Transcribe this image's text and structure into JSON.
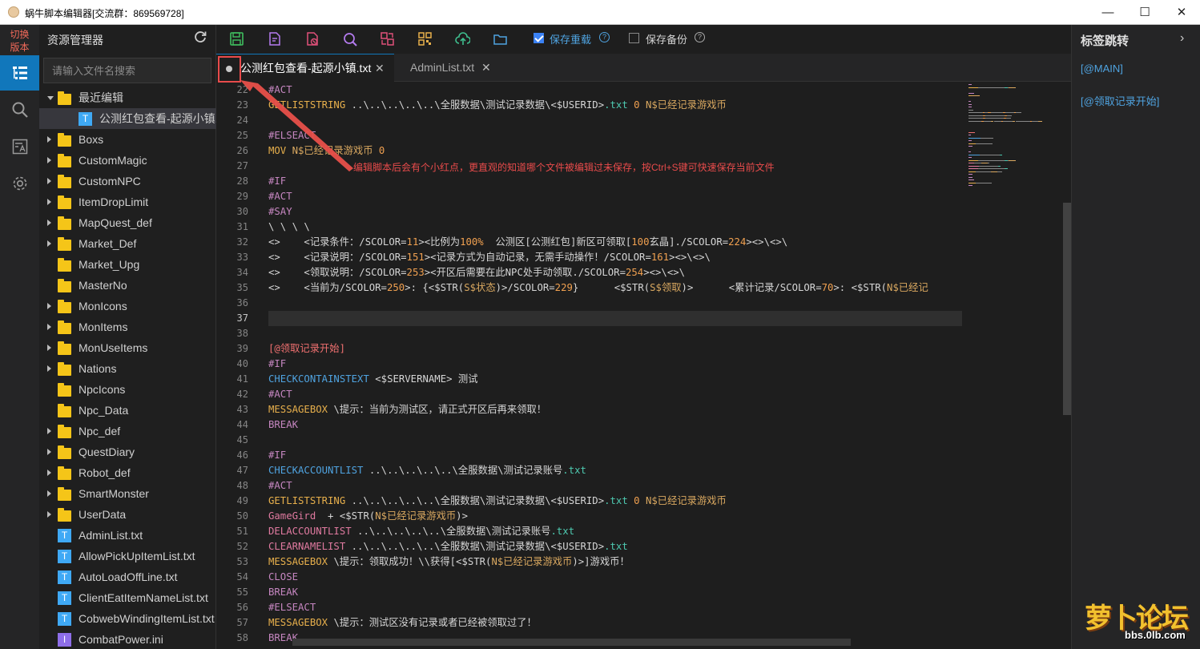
{
  "window": {
    "title": "蜗牛脚本编辑器[交流群：869569728]",
    "minimize_glyph": "—",
    "maximize_glyph": "☐",
    "close_glyph": "✕"
  },
  "activity_bar": {
    "switch_label_1": "切换",
    "switch_label_2": "版本",
    "items": [
      {
        "icon": "explorer-icon",
        "active": true
      },
      {
        "icon": "search-icon",
        "active": false
      },
      {
        "icon": "font-icon",
        "active": false
      },
      {
        "icon": "gear-icon",
        "active": false
      }
    ]
  },
  "explorer": {
    "title": "资源管理器",
    "refresh_icon": "refresh-icon",
    "search_placeholder": "请输入文件名搜索",
    "tree": [
      {
        "label": "最近编辑",
        "kind": "folder",
        "depth": 0,
        "expanded": true,
        "twisty": true
      },
      {
        "label": "公测红包查看-起源小镇.txt",
        "kind": "file",
        "depth": 1,
        "selected": true,
        "twisty": false
      },
      {
        "label": "Boxs",
        "kind": "folder",
        "depth": 0,
        "twisty": true
      },
      {
        "label": "CustomMagic",
        "kind": "folder",
        "depth": 0,
        "twisty": true
      },
      {
        "label": "CustomNPC",
        "kind": "folder",
        "depth": 0,
        "twisty": true
      },
      {
        "label": "ItemDropLimit",
        "kind": "folder",
        "depth": 0,
        "twisty": true
      },
      {
        "label": "MapQuest_def",
        "kind": "folder",
        "depth": 0,
        "twisty": true
      },
      {
        "label": "Market_Def",
        "kind": "folder",
        "depth": 0,
        "twisty": true
      },
      {
        "label": "Market_Upg",
        "kind": "folder",
        "depth": 0,
        "twisty": false
      },
      {
        "label": "MasterNo",
        "kind": "folder",
        "depth": 0,
        "twisty": false
      },
      {
        "label": "MonIcons",
        "kind": "folder",
        "depth": 0,
        "twisty": true
      },
      {
        "label": "MonItems",
        "kind": "folder",
        "depth": 0,
        "twisty": true
      },
      {
        "label": "MonUseItems",
        "kind": "folder",
        "depth": 0,
        "twisty": true
      },
      {
        "label": "Nations",
        "kind": "folder",
        "depth": 0,
        "twisty": true
      },
      {
        "label": "NpcIcons",
        "kind": "folder",
        "depth": 0,
        "twisty": false
      },
      {
        "label": "Npc_Data",
        "kind": "folder",
        "depth": 0,
        "twisty": false
      },
      {
        "label": "Npc_def",
        "kind": "folder",
        "depth": 0,
        "twisty": true
      },
      {
        "label": "QuestDiary",
        "kind": "folder",
        "depth": 0,
        "twisty": true
      },
      {
        "label": "Robot_def",
        "kind": "folder",
        "depth": 0,
        "twisty": true
      },
      {
        "label": "SmartMonster",
        "kind": "folder",
        "depth": 0,
        "twisty": true
      },
      {
        "label": "UserData",
        "kind": "folder",
        "depth": 0,
        "twisty": true
      },
      {
        "label": "AdminList.txt",
        "kind": "file",
        "depth": 0,
        "twisty": false
      },
      {
        "label": "AllowPickUpItemList.txt",
        "kind": "file",
        "depth": 0,
        "twisty": false
      },
      {
        "label": "AutoLoadOffLine.txt",
        "kind": "file",
        "depth": 0,
        "twisty": false
      },
      {
        "label": "ClientEatItemNameList.txt",
        "kind": "file",
        "depth": 0,
        "twisty": false
      },
      {
        "label": "CobwebWindingItemList.txt",
        "kind": "file",
        "depth": 0,
        "twisty": false
      },
      {
        "label": "CombatPower.ini",
        "kind": "ini",
        "depth": 0,
        "twisty": false
      }
    ]
  },
  "toolbar": {
    "buttons": [
      {
        "icon": "save-icon",
        "color": "#3fbf5f"
      },
      {
        "icon": "edit-doc-icon",
        "color": "#b57cf0"
      },
      {
        "icon": "delete-doc-icon",
        "color": "#e0507a"
      },
      {
        "icon": "find-icon",
        "color": "#b57cf0"
      },
      {
        "icon": "replace-icon",
        "color": "#e0507a"
      },
      {
        "icon": "qrcode-icon",
        "color": "#e8b04c"
      },
      {
        "icon": "upload-cloud-icon",
        "color": "#3fbf8f"
      },
      {
        "icon": "open-folder-icon",
        "color": "#4fa3e0"
      }
    ],
    "save_reload": {
      "label": "保存重载",
      "checked": true,
      "help": "?"
    },
    "save_backup": {
      "label": "保存备份",
      "checked": false,
      "help": "?"
    }
  },
  "tabs": [
    {
      "label": "公测红包查看-起源小镇.txt",
      "active": true,
      "dirty": true,
      "close": "✕"
    },
    {
      "label": "AdminList.txt",
      "active": false,
      "dirty": false,
      "close": "✕"
    }
  ],
  "editor": {
    "current_line": 37,
    "annotation": "编辑脚本后会有个小红点，更直观的知道哪个文件被编辑过未保存，按Ctrl+S键可快速保存当前文件",
    "lines": [
      {
        "n": 22,
        "seg": [
          [
            "#ACT",
            "k-sec"
          ]
        ]
      },
      {
        "n": 23,
        "seg": [
          [
            "GETLISTSTRING",
            "k-cmd"
          ],
          [
            " ..\\..\\..\\..\\..\\全服数据\\测试记录数据\\<$USERID>",
            "k-str"
          ],
          [
            ".txt",
            "k-ext"
          ],
          [
            " ",
            "k-str"
          ],
          [
            "0",
            "k-num"
          ],
          [
            " N$已经记录游戏币",
            "k-var"
          ]
        ]
      },
      {
        "n": 24,
        "seg": []
      },
      {
        "n": 25,
        "seg": [
          [
            "#ELSEACT",
            "k-sec"
          ]
        ]
      },
      {
        "n": 26,
        "seg": [
          [
            "MOV",
            "k-cmd"
          ],
          [
            " N$已经记录游戏币 ",
            "k-var"
          ],
          [
            "0",
            "k-num"
          ]
        ]
      },
      {
        "n": 27,
        "seg": []
      },
      {
        "n": 28,
        "seg": [
          [
            "#IF",
            "k-sec"
          ]
        ]
      },
      {
        "n": 29,
        "seg": [
          [
            "#ACT",
            "k-sec"
          ]
        ]
      },
      {
        "n": 30,
        "seg": [
          [
            "#SAY",
            "k-sec"
          ]
        ]
      },
      {
        "n": 31,
        "seg": [
          [
            "\\ \\ \\ \\",
            "k-str"
          ]
        ]
      },
      {
        "n": 32,
        "seg": [
          [
            "<>    <记录条件：/SCOLOR=",
            "k-str"
          ],
          [
            "11",
            "k-num"
          ],
          [
            ">",
            "k-str"
          ],
          [
            "<比例为",
            "k-str"
          ],
          [
            "100%",
            "k-num"
          ],
          [
            "  公测区[公测红包]新区可领取[",
            "k-str"
          ],
          [
            "100",
            "k-num"
          ],
          [
            "玄晶]./SCOLOR=",
            "k-str"
          ],
          [
            "224",
            "k-num"
          ],
          [
            "><>\\<>\\",
            "k-str"
          ]
        ]
      },
      {
        "n": 33,
        "seg": [
          [
            "<>    <记录说明：/SCOLOR=",
            "k-str"
          ],
          [
            "151",
            "k-num"
          ],
          [
            "><记录方式为自动记录，无需手动操作！/SCOLOR=",
            "k-str"
          ],
          [
            "161",
            "k-num"
          ],
          [
            "><>\\<>\\",
            "k-str"
          ]
        ]
      },
      {
        "n": 34,
        "seg": [
          [
            "<>    <领取说明：/SCOLOR=",
            "k-str"
          ],
          [
            "253",
            "k-num"
          ],
          [
            "><开区后需要在此NPC处手动领取./SCOLOR=",
            "k-str"
          ],
          [
            "254",
            "k-num"
          ],
          [
            "><>\\<>\\",
            "k-str"
          ]
        ]
      },
      {
        "n": 35,
        "seg": [
          [
            "<>    <当前为/SCOLOR=",
            "k-str"
          ],
          [
            "250",
            "k-num"
          ],
          [
            ">: {<$STR(",
            "k-str"
          ],
          [
            "S$状态",
            "k-var"
          ],
          [
            ")>/SCOLOR=",
            "k-str"
          ],
          [
            "229",
            "k-num"
          ],
          [
            "}      <$STR(",
            "k-str"
          ],
          [
            "S$领取",
            "k-var"
          ],
          [
            ")>      <累计记录/SCOLOR=",
            "k-str"
          ],
          [
            "70",
            "k-num"
          ],
          [
            ">: <$STR(",
            "k-str"
          ],
          [
            "N$已经记",
            "k-var"
          ]
        ]
      },
      {
        "n": 36,
        "seg": []
      },
      {
        "n": 37,
        "seg": []
      },
      {
        "n": 38,
        "seg": []
      },
      {
        "n": 39,
        "seg": [
          [
            "[@领取记录开始]",
            "k-lbl"
          ]
        ]
      },
      {
        "n": 40,
        "seg": [
          [
            "#IF",
            "k-sec"
          ]
        ]
      },
      {
        "n": 41,
        "seg": [
          [
            "CHECKCONTAINSTEXT",
            "k-blue"
          ],
          [
            " <$SERVERNAME> 测试",
            "k-str"
          ]
        ]
      },
      {
        "n": 42,
        "seg": [
          [
            "#ACT",
            "k-sec"
          ]
        ]
      },
      {
        "n": 43,
        "seg": [
          [
            "MESSAGEBOX",
            "k-cmd"
          ],
          [
            " \\提示：当前为测试区，请正式开区后再来领取！",
            "k-str"
          ]
        ]
      },
      {
        "n": 44,
        "seg": [
          [
            "BREAK",
            "k-sec"
          ]
        ]
      },
      {
        "n": 45,
        "seg": []
      },
      {
        "n": 46,
        "seg": [
          [
            "#IF",
            "k-sec"
          ]
        ]
      },
      {
        "n": 47,
        "seg": [
          [
            "CHECKACCOUNTLIST",
            "k-blue"
          ],
          [
            " ..\\..\\..\\..\\..\\全服数据\\测试记录账号",
            "k-str"
          ],
          [
            ".txt",
            "k-ext"
          ]
        ]
      },
      {
        "n": 48,
        "seg": [
          [
            "#ACT",
            "k-sec"
          ]
        ]
      },
      {
        "n": 49,
        "seg": [
          [
            "GETLISTSTRING",
            "k-cmd"
          ],
          [
            " ..\\..\\..\\..\\..\\全服数据\\测试记录数据\\<$USERID>",
            "k-str"
          ],
          [
            ".txt",
            "k-ext"
          ],
          [
            " ",
            "k-str"
          ],
          [
            "0",
            "k-num"
          ],
          [
            " N$已经记录游戏币",
            "k-var"
          ]
        ]
      },
      {
        "n": 50,
        "seg": [
          [
            "GameGird",
            "k-cmd2"
          ],
          [
            "  + <$STR(",
            "k-str"
          ],
          [
            "N$已经记录游戏币",
            "k-var"
          ],
          [
            ")>",
            "k-str"
          ]
        ]
      },
      {
        "n": 51,
        "seg": [
          [
            "DELACCOUNTLIST",
            "k-cmd2"
          ],
          [
            " ..\\..\\..\\..\\..\\全服数据\\测试记录账号",
            "k-str"
          ],
          [
            ".txt",
            "k-ext"
          ]
        ]
      },
      {
        "n": 52,
        "seg": [
          [
            "CLEARNAMELIST",
            "k-cmd2"
          ],
          [
            " ..\\..\\..\\..\\..\\全服数据\\测试记录数据\\<$USERID>",
            "k-str"
          ],
          [
            ".txt",
            "k-ext"
          ]
        ]
      },
      {
        "n": 53,
        "seg": [
          [
            "MESSAGEBOX",
            "k-cmd"
          ],
          [
            " \\提示：领取成功！\\\\获得[<$STR(",
            "k-str"
          ],
          [
            "N$已经记录游戏币",
            "k-var"
          ],
          [
            ")>]游戏币！",
            "k-str"
          ]
        ]
      },
      {
        "n": 54,
        "seg": [
          [
            "CLOSE",
            "k-sec"
          ]
        ]
      },
      {
        "n": 55,
        "seg": [
          [
            "BREAK",
            "k-sec"
          ]
        ]
      },
      {
        "n": 56,
        "seg": [
          [
            "#ELSEACT",
            "k-sec"
          ]
        ]
      },
      {
        "n": 57,
        "seg": [
          [
            "MESSAGEBOX",
            "k-cmd"
          ],
          [
            " \\提示：测试区没有记录或者已经被领取过了！",
            "k-str"
          ]
        ]
      },
      {
        "n": 58,
        "seg": [
          [
            "BREAK",
            "k-sec"
          ]
        ]
      }
    ]
  },
  "bookmarks": {
    "title": "标签跳转",
    "chevron": "›",
    "items": [
      "[@MAIN]",
      "[@领取记录开始]"
    ]
  },
  "watermark": {
    "text": "萝卜论坛",
    "url": "bbs.0lb.com"
  },
  "colors": {
    "accent": "#1177bb",
    "annotation": "#e84b4b",
    "link": "#4fa3e0"
  }
}
